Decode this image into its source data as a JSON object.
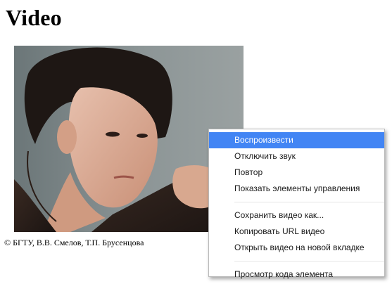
{
  "page": {
    "title": "Video"
  },
  "video": {
    "caption": "© БГТУ, В.В. Смелов, Т.П. Брусенцова"
  },
  "context_menu": {
    "group1": [
      {
        "label": "Воспроизвести",
        "active": true
      },
      {
        "label": "Отключить звук",
        "active": false
      },
      {
        "label": "Повтор",
        "active": false
      },
      {
        "label": "Показать элементы управления",
        "active": false
      }
    ],
    "group2": [
      {
        "label": "Сохранить видео как..."
      },
      {
        "label": "Копировать URL видео"
      },
      {
        "label": "Открыть видео на новой вкладке"
      }
    ],
    "group3": [
      {
        "label": "Просмотр кода элемента"
      }
    ],
    "highlight_color": "#4285f4"
  }
}
